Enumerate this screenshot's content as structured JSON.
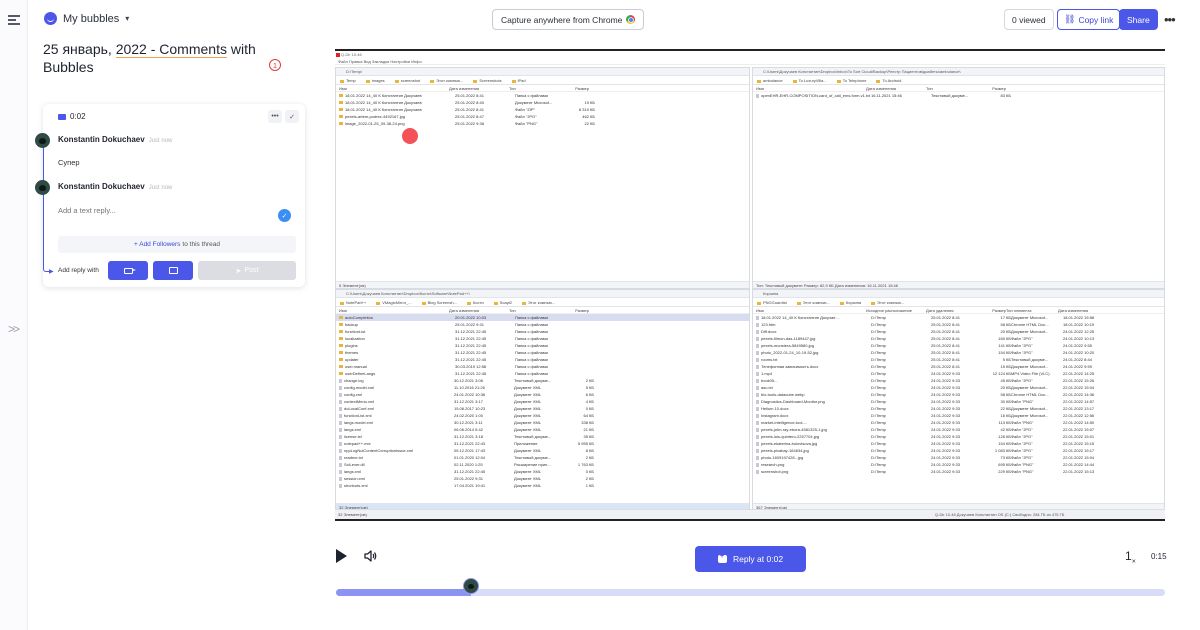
{
  "header": {
    "workspace_label": "My bubbles",
    "capture_label": "Capture anywhere from Chrome",
    "viewed_label": "0 viewed",
    "copy_link_label": "Copy link",
    "share_label": "Share"
  },
  "page": {
    "title_prefix": "25 январь, ",
    "title_underlined": "2022 - Comments",
    "title_suffix": " with Bubbles",
    "comment_count": "1"
  },
  "thread": {
    "timestamp": "0:02",
    "comments": [
      {
        "author": "Konstantin Dokuchaev",
        "time": "Just now",
        "text": "Супер"
      },
      {
        "author": "Konstantin Dokuchaev",
        "time": "Just now"
      }
    ],
    "reply_placeholder": "Add a text reply...",
    "followers_link": "+ Add Followers",
    "followers_suffix": "to this thread",
    "add_reply_with": "Add reply with",
    "post_label": "Post"
  },
  "video": {
    "window_title": "Q-Dir 10.46",
    "menu": "Файл  Правка  Вид  Закладки  Настройки  Инфо",
    "left_top": {
      "path": "D:\\Temp\\",
      "tabs": [
        "Temp",
        "images",
        "screenshot",
        "Этот компью...",
        "Screenshots",
        "iPad"
      ],
      "columns": [
        "Имя",
        "Дата изменения",
        "Тип",
        "Размер"
      ],
      "rows": [
        {
          "name": "18.01.2022 14_40 К Константин Докучаев",
          "date": "25.01.2022 8:41",
          "type": "Папка с файлами",
          "size": ""
        },
        {
          "name": "18.01.2022 14_40 К Константин Докучаев",
          "date": "25.01.2022 8:40",
          "type": "Документ Microsof...",
          "size": "19 КБ"
        },
        {
          "name": "18.01.2022 14_40 К Константин Докучаев",
          "date": "25.01.2022 8:41",
          "type": "Файл \"ZIP\"",
          "size": "8 310 КБ"
        },
        {
          "name": "pexels-artem-podrez-4492167.jpg",
          "date": "25.01.2022 8:47",
          "type": "Файл \"JPG\"",
          "size": "462 КБ"
        },
        {
          "name": "image_2022-01-25_09-38-24.png",
          "date": "25.01.2022 9:38",
          "type": "Файл \"PNG\"",
          "size": "22 КБ"
        }
      ],
      "status": "5 Элемент(ов)"
    },
    "right_top": {
      "path": "C:\\Users\\Докучаев Константин\\Dropbox\\Inbox\\To Sort Cloud\\Backup\\Реестр Пациентов\\диабеты\\ambulance\\",
      "tabs": [
        "ambulance",
        "To LuxuryVilla...",
        "To Telephone",
        "To Android"
      ],
      "columns": [
        "Имя",
        "Дата изменения",
        "Тип",
        "Размер"
      ],
      "rows": [
        {
          "name": "openEHR-EHR-COMPOSITION.card_of_call_ems.form.v1.txt",
          "date": "16.11.2021 15:46",
          "type": "Текстовый докуме...",
          "size": "83 КБ"
        }
      ],
      "status": "Тип: Текстовый документ Размер: 82,9 КБ Дата изменения: 16.11.2021 15:46"
    },
    "left_bot": {
      "path": "C:\\Users\\Докучаев Константин\\Dropbox\\Кости\\Software\\NotePad++\\",
      "tabs": [
        "NotePad++",
        "VMagicMirror_...",
        "Blog Screensh...",
        "Кости",
        "Soapl2",
        "Этот компью..."
      ],
      "columns": [
        "Имя",
        "Дата изменения",
        "Тип",
        "Размер"
      ],
      "rows": [
        {
          "name": "autoCompletion",
          "date": "20.01.2022 10:03",
          "type": "Папка с файлами",
          "size": "",
          "folder": true,
          "sel": true
        },
        {
          "name": "backup",
          "date": "25.01.2022 9:31",
          "type": "Папка с файлами",
          "size": "",
          "folder": true
        },
        {
          "name": "functionList",
          "date": "31.12.2021 22:45",
          "type": "Папка с файлами",
          "size": "",
          "folder": true
        },
        {
          "name": "localization",
          "date": "31.12.2021 22:45",
          "type": "Папка с файлами",
          "size": "",
          "folder": true
        },
        {
          "name": "plugins",
          "date": "31.12.2021 22:45",
          "type": "Папка с файлами",
          "size": "",
          "folder": true
        },
        {
          "name": "themes",
          "date": "31.12.2021 22:45",
          "type": "Папка с файлами",
          "size": "",
          "folder": true
        },
        {
          "name": "updater",
          "date": "31.12.2021 22:45",
          "type": "Папка с файлами",
          "size": "",
          "folder": true
        },
        {
          "name": "user.manual",
          "date": "30.03.2019 12:58",
          "type": "Папка с файлами",
          "size": "",
          "folder": true
        },
        {
          "name": "userDefineLangs",
          "date": "31.12.2021 22:45",
          "type": "Папка с файлами",
          "size": "",
          "folder": true
        },
        {
          "name": "change.log",
          "date": "30.12.2021 3:06",
          "type": "Текстовый докуме...",
          "size": "2 КБ"
        },
        {
          "name": "config.model.xml",
          "date": "11.10.2016 21:26",
          "type": "Документ XML",
          "size": "5 КБ"
        },
        {
          "name": "config.xml",
          "date": "24.01.2022 10:36",
          "type": "Документ XML",
          "size": "6 КБ"
        },
        {
          "name": "contextMenu.xml",
          "date": "31.12.2021 3:17",
          "type": "Документ XML",
          "size": "4 КБ"
        },
        {
          "name": "doLocalConf.xml",
          "date": "15.08.2017 10:23",
          "type": "Документ XML",
          "size": "0 КБ"
        },
        {
          "name": "functionList.xml",
          "date": "24.02.2020 1:00",
          "type": "Документ XML",
          "size": "64 КБ"
        },
        {
          "name": "langs.model.xml",
          "date": "30.12.2021 3:11",
          "type": "Документ XML",
          "size": "338 КБ"
        },
        {
          "name": "langs.xml",
          "date": "06.06.2014 5:42",
          "type": "Документ XML",
          "size": "21 КБ"
        },
        {
          "name": "license.txt",
          "date": "31.12.2021 3:18",
          "type": "Текстовый докуме...",
          "size": "35 КБ"
        },
        {
          "name": "notepad++.exe",
          "date": "31.12.2021 22:43",
          "type": "Приложение",
          "size": "5 955 КБ"
        },
        {
          "name": "nppLogNulContentCorruptionIssue.xml",
          "date": "05.12.2021 17:43",
          "type": "Документ XML",
          "size": "8 КБ"
        },
        {
          "name": "readme.txt",
          "date": "01.01.2020 12:04",
          "type": "Текстовый докуме...",
          "size": "2 КБ"
        },
        {
          "name": "SciLexer.dll",
          "date": "02.11.2020 1:25",
          "type": "Расширение прил...",
          "size": "1 763 КБ"
        },
        {
          "name": "langs.xml",
          "date": "31.12.2021 22:45",
          "type": "Документ XML",
          "size": "0 КБ"
        },
        {
          "name": "session.xml",
          "date": "25.01.2022 9:31",
          "type": "Документ XML",
          "size": "2 КБ"
        },
        {
          "name": "shortcuts.xml",
          "date": "17.04.2021 19:41",
          "type": "Документ XML",
          "size": "1 КБ"
        }
      ],
      "status": "32 Элемент(ов)"
    },
    "right_bot": {
      "path": "Корзина",
      "tabs": [
        "PNGGuardist",
        "Этот компью...",
        "Корзина",
        "Этот компью..."
      ],
      "columns": [
        "Имя",
        "Исходное расположение",
        "Дата удаления",
        "Размер",
        "Тип элемента",
        "Дата изменения"
      ],
      "rows": [
        {
          "name": "18.01.2022 14_40 К Константин Докучае...",
          "loc": "D:\\Temp",
          "date": "25.01.2022 8:41",
          "size": "17 КБ",
          "type": "Документ Microsof...",
          "mod": "18.01.2022 15:58"
        },
        {
          "name": "123.htm",
          "loc": "D:\\Temp",
          "date": "25.01.2022 8:41",
          "size": "58 КБ",
          "type": "Chrome HTML Doc...",
          "mod": "18.01.2022 10:19"
        },
        {
          "name": "Diff.docx",
          "loc": "D:\\Temp",
          "date": "25.01.2022 8:41",
          "size": "20 КБ",
          "type": "Документ Microsof...",
          "mod": "24.01.2022 12:25"
        },
        {
          "name": "pexels-filmon-das-1189447.jpg",
          "loc": "D:\\Temp",
          "date": "25.01.2022 8:41",
          "size": "160 КБ",
          "type": "Файл \"JPG\"",
          "mod": "24.01.2022 10:13"
        },
        {
          "name": "pexels-monstera-5849580.jpg",
          "loc": "D:\\Temp",
          "date": "25.01.2022 8:41",
          "size": "141 КБ",
          "type": "Файл \"JPG\"",
          "mod": "24.01.2022 9:55"
        },
        {
          "name": "photo_2022-01-24_10-19-52.jpg",
          "loc": "D:\\Temp",
          "date": "25.01.2022 8:41",
          "size": "154 КБ",
          "type": "Файл \"JPG\"",
          "mod": "24.01.2022 10:20"
        },
        {
          "name": "rooms.txt",
          "loc": "D:\\Temp",
          "date": "25.01.2022 8:41",
          "size": "5 КБ",
          "type": "Текстовый докуме...",
          "mod": "24.01.2022 8:44"
        },
        {
          "name": "Телефонная зависимость.docx",
          "loc": "D:\\Temp",
          "date": "25.01.2022 8:41",
          "size": "15 КБ",
          "type": "Документ Microsof...",
          "mod": "24.01.2022 9:59"
        },
        {
          "name": "1.mp4",
          "loc": "D:\\Temp",
          "date": "24.01.2022 9:33",
          "size": "12 124 КБ",
          "type": "MP4 Video File (VLC)",
          "mod": "22.01.2022 14:25"
        },
        {
          "name": "book05...",
          "loc": "D:\\Temp",
          "date": "24.01.2022 9:33",
          "size": "45 КБ",
          "type": "Файл \"JPG\"",
          "mod": "22.01.2022 15:26"
        },
        {
          "name": "asu.txt",
          "loc": "D:\\Temp",
          "date": "24.01.2022 9:33",
          "size": "20 КБ",
          "type": "Документ Microsof...",
          "mod": "22.01.2022 15:04"
        },
        {
          "name": "bio-tools-datacube.webp",
          "loc": "D:\\Temp",
          "date": "24.01.2022 9:33",
          "size": "58 КБ",
          "type": "Chrome HTML Doc...",
          "mod": "22.01.2022 14:36"
        },
        {
          "name": "Diagnostics-Dashboard-Monitor.png",
          "loc": "D:\\Temp",
          "date": "24.01.2022 9:33",
          "size": "30 КБ",
          "type": "Файл \"PNG\"",
          "mod": "22.01.2022 14:57"
        },
        {
          "name": "Helium 10.docx",
          "loc": "D:\\Temp",
          "date": "24.01.2022 9:33",
          "size": "22 КБ",
          "type": "Документ Microsof...",
          "mod": "22.01.2022 13:17"
        },
        {
          "name": "Instagram.docx",
          "loc": "D:\\Temp",
          "date": "24.01.2022 9:33",
          "size": "16 КБ",
          "type": "Документ Microsof...",
          "mod": "22.01.2022 12:56"
        },
        {
          "name": "market-intelligence-tool-...",
          "loc": "D:\\Temp",
          "date": "24.01.2022 9:33",
          "size": "113 КБ",
          "type": "Файл \"PNG\"",
          "mod": "22.01.2022 14:50"
        },
        {
          "name": "pexels-john-ray-ebora-4581325-1.jpg",
          "loc": "D:\\Temp",
          "date": "24.01.2022 9:33",
          "size": "42 КБ",
          "type": "Файл \"JPG\"",
          "mod": "22.01.2022 15:07"
        },
        {
          "name": "pexels-luis-quintero-2257704.jpg",
          "loc": "D:\\Temp",
          "date": "24.01.2022 9:33",
          "size": "126 КБ",
          "type": "Файл \"JPG\"",
          "mod": "22.01.2022 15:01"
        },
        {
          "name": "pexels-ekaterina-bolovtsova.jpg",
          "loc": "D:\\Temp",
          "date": "24.01.2022 9:33",
          "size": "154 КБ",
          "type": "Файл \"JPG\"",
          "mod": "22.01.2022 15:15"
        },
        {
          "name": "pexels-pixabay-164634.jpg",
          "loc": "D:\\Temp",
          "date": "24.01.2022 9:33",
          "size": "1 083 КБ",
          "type": "Файл \"JPG\"",
          "mod": "22.01.2022 15:17"
        },
        {
          "name": "photo-1609197428...jpg",
          "loc": "D:\\Temp",
          "date": "24.01.2022 9:33",
          "size": "73 КБ",
          "type": "Файл \"JPG\"",
          "mod": "22.01.2022 15:04"
        },
        {
          "name": "research.png",
          "loc": "D:\\Temp",
          "date": "24.01.2022 9:33",
          "size": "695 КБ",
          "type": "Файл \"PNG\"",
          "mod": "22.01.2022 14:44"
        },
        {
          "name": "screenshot.png",
          "loc": "D:\\Temp",
          "date": "24.01.2022 9:33",
          "size": "229 КБ",
          "type": "Файл \"PNG\"",
          "mod": "22.01.2022 15:13"
        }
      ],
      "status": "367 Элемент(ов)"
    },
    "taskbar": "32 Элемент(ов)",
    "tray": "Q-Dir 10.46   Докучаев Константин   OS (C:)   Свободно: 284 ГБ из 475 ГБ"
  },
  "player": {
    "reply_at_label": "Reply at 0:02",
    "speed": "1",
    "speed_suffix": "×",
    "duration": "0:15",
    "progress_fraction": 0.163
  },
  "colors": {
    "accent": "#4b57e8",
    "progress_track": "#d9dcf8",
    "progress_fill": "#8b94f0",
    "title_underline": "#f4a24a",
    "badge": "#e23b3b"
  }
}
